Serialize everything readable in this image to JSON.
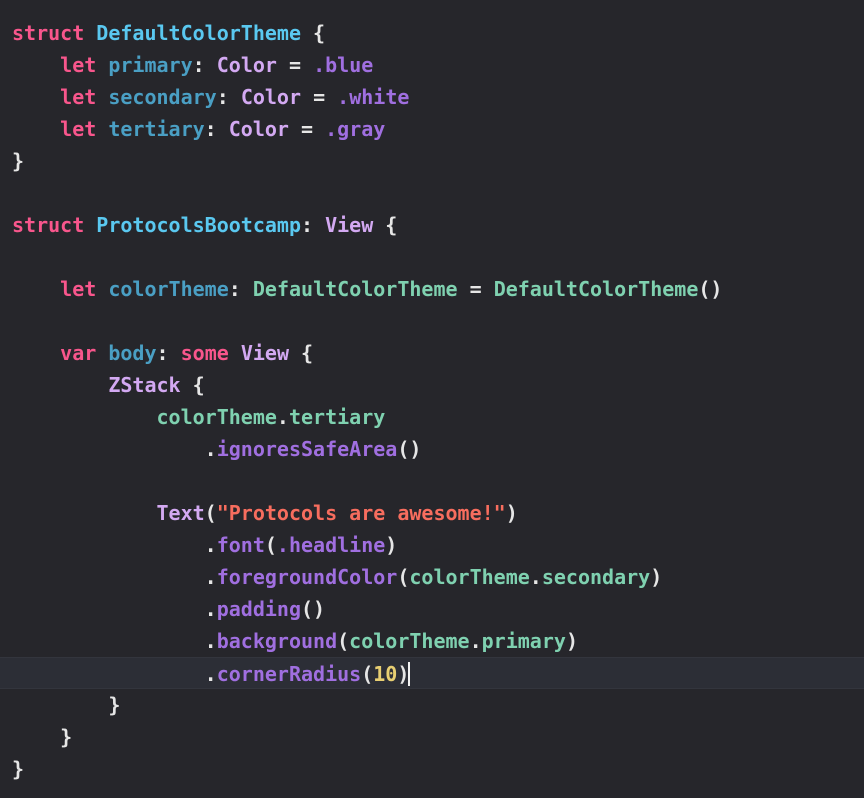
{
  "editor": {
    "language": "Swift",
    "background_color": "#26262b",
    "active_line_color": "#2c2e36",
    "caret_color": "#f2f2f2",
    "active_line_number": 20,
    "palette": {
      "keyword": "#f8568c",
      "type_declaration": "#5ac8f0",
      "identifier": "#4a9fc4",
      "type": "#d3a9f2",
      "enum_case": "#a06fe0",
      "plain": "#e6e6e6",
      "member": "#7fd1b0",
      "string": "#f76d5e",
      "number": "#e8cf72"
    }
  },
  "code": {
    "lines": [
      {
        "n": 1,
        "indent": 0,
        "active": false,
        "tokens": [
          {
            "t": "struct",
            "c": "kw"
          },
          {
            "t": " ",
            "c": "plain"
          },
          {
            "t": "DefaultColorTheme",
            "c": "type-decl"
          },
          {
            "t": " {",
            "c": "plain"
          }
        ]
      },
      {
        "n": 2,
        "indent": 1,
        "active": false,
        "tokens": [
          {
            "t": "let",
            "c": "kw"
          },
          {
            "t": " ",
            "c": "plain"
          },
          {
            "t": "primary",
            "c": "ident"
          },
          {
            "t": ": ",
            "c": "plain"
          },
          {
            "t": "Color",
            "c": "type"
          },
          {
            "t": " = ",
            "c": "plain"
          },
          {
            "t": ".blue",
            "c": "enum"
          }
        ]
      },
      {
        "n": 3,
        "indent": 1,
        "active": false,
        "tokens": [
          {
            "t": "let",
            "c": "kw"
          },
          {
            "t": " ",
            "c": "plain"
          },
          {
            "t": "secondary",
            "c": "ident"
          },
          {
            "t": ": ",
            "c": "plain"
          },
          {
            "t": "Color",
            "c": "type"
          },
          {
            "t": " = ",
            "c": "plain"
          },
          {
            "t": ".white",
            "c": "enum"
          }
        ]
      },
      {
        "n": 4,
        "indent": 1,
        "active": false,
        "tokens": [
          {
            "t": "let",
            "c": "kw"
          },
          {
            "t": " ",
            "c": "plain"
          },
          {
            "t": "tertiary",
            "c": "ident"
          },
          {
            "t": ": ",
            "c": "plain"
          },
          {
            "t": "Color",
            "c": "type"
          },
          {
            "t": " = ",
            "c": "plain"
          },
          {
            "t": ".gray",
            "c": "enum"
          }
        ]
      },
      {
        "n": 5,
        "indent": 0,
        "active": false,
        "tokens": [
          {
            "t": "}",
            "c": "plain"
          }
        ]
      },
      {
        "n": 6,
        "indent": 0,
        "active": false,
        "tokens": []
      },
      {
        "n": 7,
        "indent": 0,
        "active": false,
        "tokens": [
          {
            "t": "struct",
            "c": "kw"
          },
          {
            "t": " ",
            "c": "plain"
          },
          {
            "t": "ProtocolsBootcamp",
            "c": "type-decl"
          },
          {
            "t": ": ",
            "c": "plain"
          },
          {
            "t": "View",
            "c": "type"
          },
          {
            "t": " {",
            "c": "plain"
          }
        ]
      },
      {
        "n": 8,
        "indent": 0,
        "active": false,
        "tokens": []
      },
      {
        "n": 9,
        "indent": 1,
        "active": false,
        "tokens": [
          {
            "t": "let",
            "c": "kw"
          },
          {
            "t": " ",
            "c": "plain"
          },
          {
            "t": "colorTheme",
            "c": "ident"
          },
          {
            "t": ": ",
            "c": "plain"
          },
          {
            "t": "DefaultColorTheme",
            "c": "member"
          },
          {
            "t": " = ",
            "c": "plain"
          },
          {
            "t": "DefaultColorTheme",
            "c": "member"
          },
          {
            "t": "()",
            "c": "plain"
          }
        ]
      },
      {
        "n": 10,
        "indent": 0,
        "active": false,
        "tokens": []
      },
      {
        "n": 11,
        "indent": 1,
        "active": false,
        "tokens": [
          {
            "t": "var",
            "c": "kw"
          },
          {
            "t": " ",
            "c": "plain"
          },
          {
            "t": "body",
            "c": "ident"
          },
          {
            "t": ": ",
            "c": "plain"
          },
          {
            "t": "some",
            "c": "kw"
          },
          {
            "t": " ",
            "c": "plain"
          },
          {
            "t": "View",
            "c": "type"
          },
          {
            "t": " {",
            "c": "plain"
          }
        ]
      },
      {
        "n": 12,
        "indent": 2,
        "active": false,
        "tokens": [
          {
            "t": "ZStack",
            "c": "type"
          },
          {
            "t": " {",
            "c": "plain"
          }
        ]
      },
      {
        "n": 13,
        "indent": 3,
        "active": false,
        "tokens": [
          {
            "t": "colorTheme",
            "c": "member"
          },
          {
            "t": ".",
            "c": "plain"
          },
          {
            "t": "tertiary",
            "c": "member"
          }
        ]
      },
      {
        "n": 14,
        "indent": 4,
        "active": false,
        "tokens": [
          {
            "t": ".",
            "c": "plain"
          },
          {
            "t": "ignoresSafeArea",
            "c": "enum"
          },
          {
            "t": "()",
            "c": "plain"
          }
        ]
      },
      {
        "n": 15,
        "indent": 0,
        "active": false,
        "tokens": []
      },
      {
        "n": 16,
        "indent": 3,
        "active": false,
        "tokens": [
          {
            "t": "Text",
            "c": "type"
          },
          {
            "t": "(",
            "c": "plain"
          },
          {
            "t": "\"Protocols are awesome!\"",
            "c": "string"
          },
          {
            "t": ")",
            "c": "plain"
          }
        ]
      },
      {
        "n": 17,
        "indent": 4,
        "active": false,
        "tokens": [
          {
            "t": ".",
            "c": "plain"
          },
          {
            "t": "font",
            "c": "enum"
          },
          {
            "t": "(",
            "c": "plain"
          },
          {
            "t": ".headline",
            "c": "enum"
          },
          {
            "t": ")",
            "c": "plain"
          }
        ]
      },
      {
        "n": 18,
        "indent": 4,
        "active": false,
        "tokens": [
          {
            "t": ".",
            "c": "plain"
          },
          {
            "t": "foregroundColor",
            "c": "enum"
          },
          {
            "t": "(",
            "c": "plain"
          },
          {
            "t": "colorTheme",
            "c": "member"
          },
          {
            "t": ".",
            "c": "plain"
          },
          {
            "t": "secondary",
            "c": "member"
          },
          {
            "t": ")",
            "c": "plain"
          }
        ]
      },
      {
        "n": 19,
        "indent": 4,
        "active": false,
        "tokens": [
          {
            "t": ".",
            "c": "plain"
          },
          {
            "t": "padding",
            "c": "enum"
          },
          {
            "t": "()",
            "c": "plain"
          }
        ]
      },
      {
        "n": 20,
        "indent": 4,
        "active": false,
        "tokens": [
          {
            "t": ".",
            "c": "plain"
          },
          {
            "t": "background",
            "c": "enum"
          },
          {
            "t": "(",
            "c": "plain"
          },
          {
            "t": "colorTheme",
            "c": "member"
          },
          {
            "t": ".",
            "c": "plain"
          },
          {
            "t": "primary",
            "c": "member"
          },
          {
            "t": ")",
            "c": "plain"
          }
        ]
      },
      {
        "n": 21,
        "indent": 4,
        "active": true,
        "caret": true,
        "tokens": [
          {
            "t": ".",
            "c": "plain"
          },
          {
            "t": "cornerRadius",
            "c": "enum"
          },
          {
            "t": "(",
            "c": "plain"
          },
          {
            "t": "10",
            "c": "number"
          },
          {
            "t": ")",
            "c": "plain"
          }
        ]
      },
      {
        "n": 22,
        "indent": 2,
        "active": false,
        "tokens": [
          {
            "t": "}",
            "c": "plain"
          }
        ]
      },
      {
        "n": 23,
        "indent": 1,
        "active": false,
        "tokens": [
          {
            "t": "}",
            "c": "plain"
          }
        ]
      },
      {
        "n": 24,
        "indent": 0,
        "active": false,
        "tokens": [
          {
            "t": "}",
            "c": "plain"
          }
        ]
      }
    ]
  }
}
